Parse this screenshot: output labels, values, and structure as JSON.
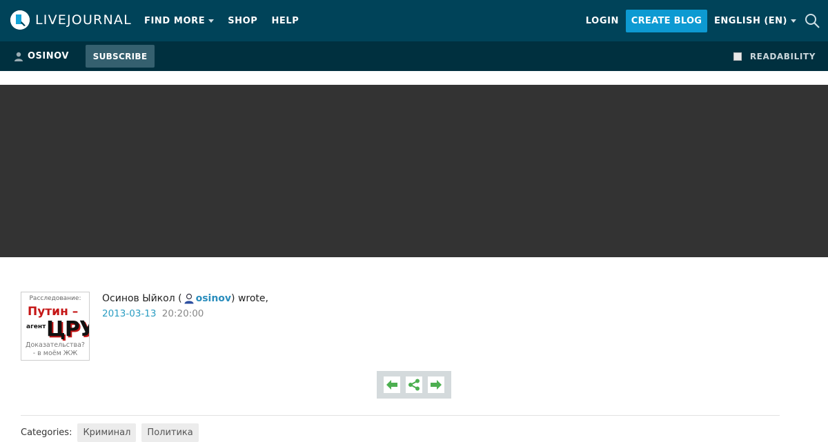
{
  "header": {
    "logo_text": "LIVEJOURNAL",
    "nav": [
      {
        "label": "FIND MORE",
        "has_dropdown": true
      },
      {
        "label": "SHOP",
        "has_dropdown": false
      },
      {
        "label": "HELP",
        "has_dropdown": false
      }
    ],
    "login_label": "LOGIN",
    "create_blog_label": "CREATE BLOG",
    "language_label": "ENGLISH (EN)"
  },
  "subbar": {
    "username": "OSINOV",
    "subscribe_label": "SUBSCRIBE",
    "readability_label": "READABILITY",
    "readability_checked": false
  },
  "post": {
    "avatar": {
      "line1": "Расследование:",
      "line2": "Путин –",
      "line3": "агент",
      "line4": "ЦРУ",
      "line5": "Доказательства?",
      "line6": "- в моём ЖЖ"
    },
    "author_name": "Осинов Ыйкол (",
    "author_username": "osinov",
    "wrote": ") wrote,",
    "date": "2013-03-13",
    "time": "20:20:00"
  },
  "post_nav": {
    "icons": [
      "arrow-left-icon",
      "share-icon",
      "arrow-right-icon"
    ]
  },
  "categories": {
    "label": "Categories:",
    "tags": [
      "Криминал",
      "Политика"
    ]
  },
  "colors": {
    "topbar": "#004359",
    "subbar": "#00303f",
    "accent": "#0d9ad2",
    "banner": "#333333",
    "nav_icon": "#4caf50"
  }
}
